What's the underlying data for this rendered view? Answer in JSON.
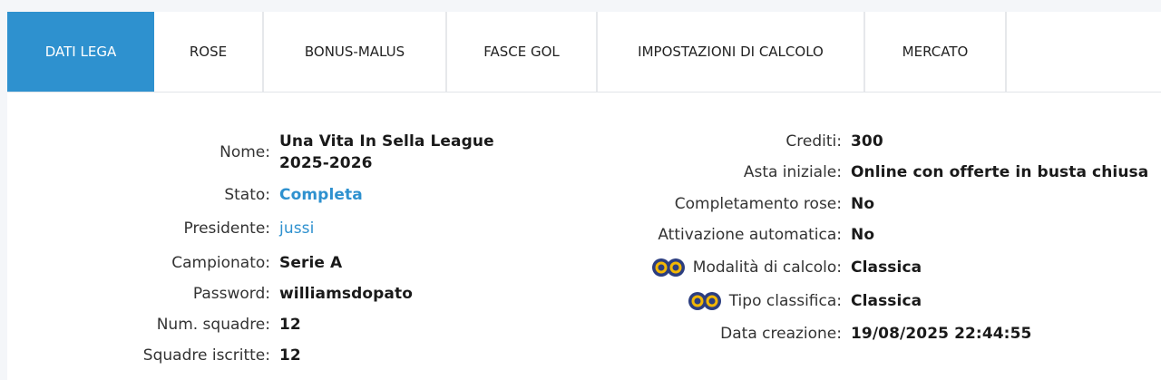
{
  "tabs": [
    {
      "label": "DATI LEGA",
      "active": true
    },
    {
      "label": "ROSE",
      "active": false
    },
    {
      "label": "BONUS-MALUS",
      "active": false
    },
    {
      "label": "FASCE GOL",
      "active": false
    },
    {
      "label": "IMPOSTAZIONI DI CALCOLO",
      "active": false
    },
    {
      "label": "MERCATO",
      "active": false
    }
  ],
  "left": {
    "nome_label": "Nome:",
    "nome_line1": "Una Vita In Sella League",
    "nome_line2": "2025-2026",
    "stato_label": "Stato:",
    "stato_value": "Completa",
    "presidente_label": "Presidente:",
    "presidente_value": "jussi",
    "campionato_label": "Campionato:",
    "campionato_value": "Serie A",
    "password_label": "Password:",
    "password_value": "williamsdopato",
    "num_squadre_label": "Num. squadre:",
    "num_squadre_value": "12",
    "squadre_iscritte_label": "Squadre iscritte:",
    "squadre_iscritte_value": "12"
  },
  "right": {
    "crediti_label": "Crediti:",
    "crediti_value": "300",
    "asta_label": "Asta iniziale:",
    "asta_value": "Online con offerte in busta chiusa",
    "completamento_label": "Completamento rose:",
    "completamento_value": "No",
    "attivazione_label": "Attivazione automatica:",
    "attivazione_value": "No",
    "modalita_label": "Modalità di calcolo:",
    "modalita_value": "Classica",
    "tipo_label": "Tipo classifica:",
    "tipo_value": "Classica",
    "data_label": "Data creazione:",
    "data_value": "19/08/2025 22:44:55"
  },
  "colors": {
    "accent": "#2e91cf",
    "icon_dark": "#2c3e80",
    "icon_gold": "#f2b705"
  },
  "icons": {
    "classic_calc_icon": "gold-double-ring-badge"
  }
}
